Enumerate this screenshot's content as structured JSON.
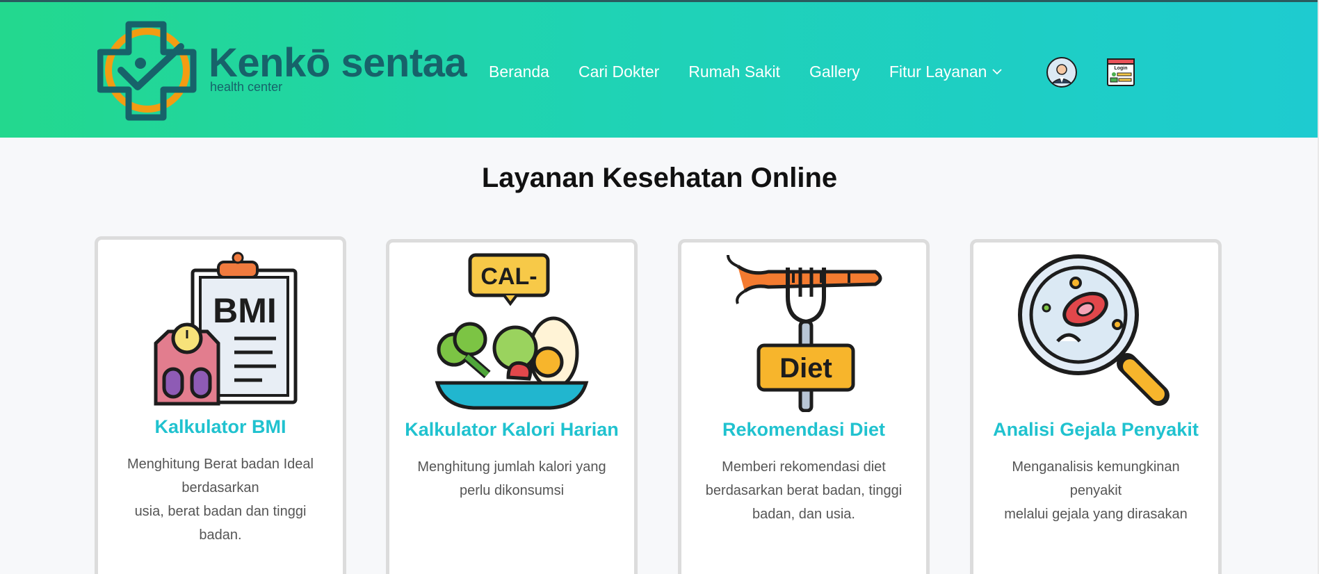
{
  "brand": {
    "name": "Kenkō sentaa",
    "tagline": "health center"
  },
  "nav": {
    "items": [
      "Beranda",
      "Cari Dokter",
      "Rumah Sakit",
      "Gallery",
      "Fitur Layanan"
    ],
    "profile_icon": "doctor-avatar-icon",
    "login_icon": "login-form-icon",
    "login_icon_text": "Login"
  },
  "section": {
    "title": "Layanan Kesehatan Online"
  },
  "cards": [
    {
      "title": "Kalkulator BMI",
      "icon": "bmi-clipboard-scale-icon",
      "icon_text": "BMI",
      "desc": [
        "Menghitung Berat badan Ideal berdasarkan",
        "usia, berat badan dan tinggi badan."
      ]
    },
    {
      "title": "Kalkulator Kalori Harian",
      "icon": "salad-bowl-calorie-icon",
      "icon_text": "CAL-",
      "desc": [
        "Menghitung jumlah kalori yang perlu dikonsumsi"
      ]
    },
    {
      "title": "Rekomendasi Diet",
      "icon": "carrot-fork-diet-icon",
      "icon_text": "Diet",
      "desc": [
        "Memberi rekomendasi diet berdasarkan berat badan, tinggi badan, dan usia."
      ]
    },
    {
      "title": "Analisi Gejala Penyakit",
      "icon": "magnifier-bacteria-icon",
      "desc": [
        "Menganalisis kemungkinan penyakit",
        "melalui gejala yang dirasakan"
      ]
    }
  ],
  "colors": {
    "header_start": "#23d88e",
    "header_end": "#1ecbd0",
    "brand": "#17626a",
    "card_title": "#20c2cf",
    "logo_orange": "#f39c12"
  }
}
